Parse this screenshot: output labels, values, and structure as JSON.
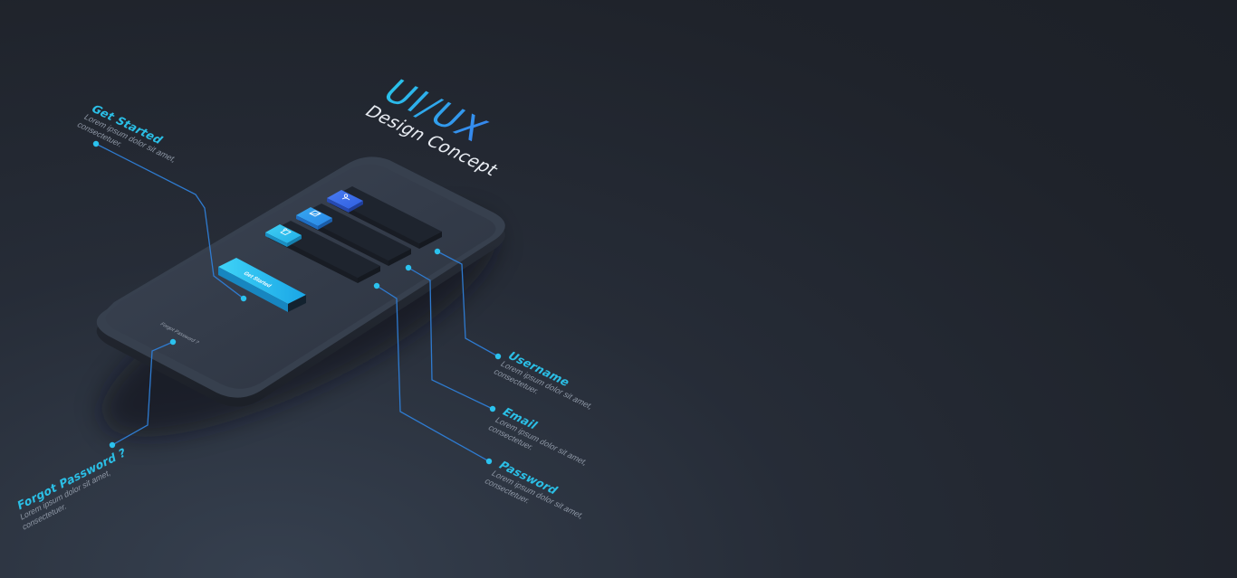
{
  "headline": {
    "main": "UI/UX",
    "sub": "Design Concept"
  },
  "phone": {
    "button_label": "Get Started",
    "link_label": "Forgot Password ?"
  },
  "callouts": {
    "get_started": {
      "title": "Get Started",
      "desc": "Lorem ipsum dolor sit amet, consectetuer."
    },
    "username": {
      "title": "Username",
      "desc": "Lorem ipsum dolor sit amet, consectetuer."
    },
    "email": {
      "title": "Email",
      "desc": "Lorem ipsum dolor sit amet, consectetuer."
    },
    "password": {
      "title": "Password",
      "desc": "Lorem ipsum dolor sit amet, consectetuer."
    },
    "forgot_password": {
      "title": "Forgot Password ?",
      "desc": "Lorem ipsum dolor sit amet, consectetuer."
    }
  },
  "icons": {
    "username": "user-icon",
    "email": "envelope-icon",
    "password": "lock-icon"
  },
  "colors": {
    "accent_cyan": "#2bbfe6",
    "accent_blue": "#3b6ff0",
    "background": "#1f232b",
    "phone_body": "#38414f",
    "field": "#1f2530"
  }
}
